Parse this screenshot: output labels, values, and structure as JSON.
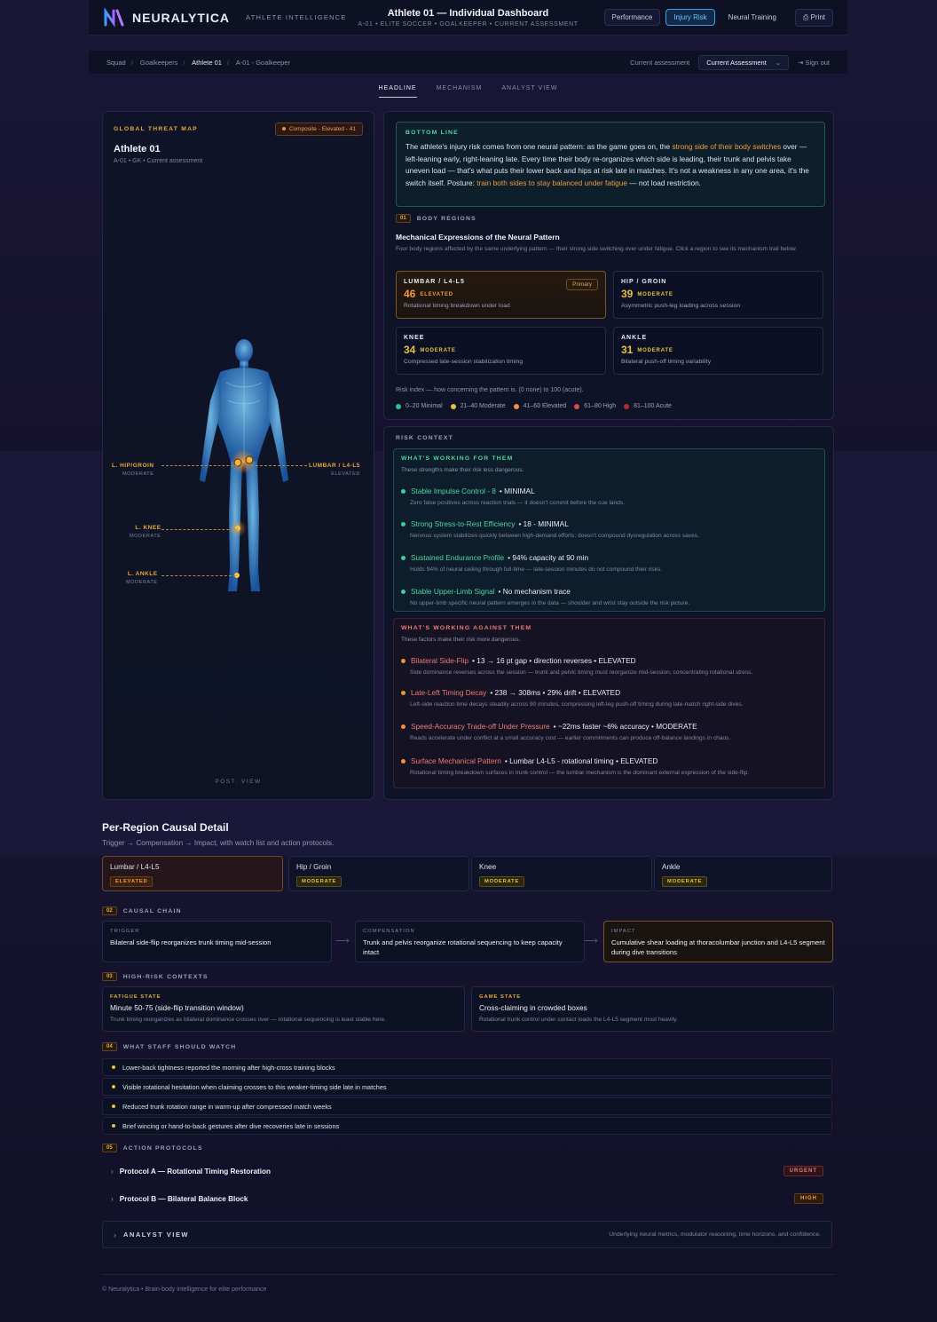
{
  "topbar": {
    "logo": "NEURALYTICA",
    "subtitle": "ATHLETE INTELLIGENCE",
    "title": "Athlete 01 — Individual Dashboard",
    "meta": "A-01  •  ELITE SOCCER  •  GOALKEEPER  •  CURRENT ASSESSMENT",
    "nav": [
      "Performance",
      "Injury Risk",
      "Neural Training"
    ],
    "print": "Print"
  },
  "crumbs": {
    "items": [
      "Squad",
      "Goalkeepers",
      "Athlete 01",
      "A-01 - Goalkeeper"
    ],
    "current_label": "Current assessment",
    "select": "Current Assessment",
    "signout": "Sign out"
  },
  "tabs": [
    "HEADLINE",
    "MECHANISM",
    "ANALYST VIEW"
  ],
  "left": {
    "title": "GLOBAL THREAT MAP",
    "composite": "Composite - Elevated - 41",
    "name": "Athlete 01",
    "sub": "A-01  •  GK  •  Current assessment",
    "callouts": [
      {
        "name": "L. HIP/GROIN",
        "level": "MODERATE"
      },
      {
        "name": "LUMBAR / L4-L5",
        "level": "ELEVATED"
      },
      {
        "name": "L. KNEE",
        "level": "MODERATE"
      },
      {
        "name": "L. ANKLE",
        "level": "MODERATE"
      }
    ],
    "view": "POST. VIEW"
  },
  "bottomline": {
    "title": "BOTTOM LINE",
    "p1": "The athlete's injury risk comes from one neural pattern: as the game goes on, the ",
    "h1": "strong side of their body switches",
    "p2": " over — left-leaning early, right-leaning late. Every time their body re-organizes which side is leading, their trunk and pelvis take uneven load — that's what puts their lower back and hips at risk late in matches. It's not a weakness in any one area, it's the switch itself. Posture: ",
    "h2": "train both sides to stay balanced under fatigue",
    "p3": " — not load restriction."
  },
  "regions": {
    "num": "01",
    "title": "BODY REGIONS",
    "heading": "Mechanical Expressions of the Neural Pattern",
    "desc": "Four body regions affected by the same underlying pattern — their strong side switching over under fatigue. Click a region to see its mechanism trail below.",
    "cards": [
      {
        "name": "LUMBAR / L4-L5",
        "score": "46",
        "level": "ELEVATED",
        "desc": "Rotational timing breakdown under load",
        "tag": "Primary"
      },
      {
        "name": "HIP / GROIN",
        "score": "39",
        "level": "MODERATE",
        "desc": "Asymmetric push-leg loading across session"
      },
      {
        "name": "KNEE",
        "score": "34",
        "level": "MODERATE",
        "desc": "Compressed late-session stabilization timing"
      },
      {
        "name": "ANKLE",
        "score": "31",
        "level": "MODERATE",
        "desc": "Bilateral push-off timing variability"
      }
    ],
    "risk_note": "Risk index — how concerning the pattern is. (0 none) to 100 (acute).",
    "legend": [
      {
        "label": "0–20 Minimal",
        "color": "#2fbf8f"
      },
      {
        "label": "21–40 Moderate",
        "color": "#e4c03d"
      },
      {
        "label": "41–60 Elevated",
        "color": "#f2913c"
      },
      {
        "label": "61–80 High",
        "color": "#e04848"
      },
      {
        "label": "81–100 Acute",
        "color": "#b8282e"
      }
    ]
  },
  "risk": {
    "title": "RISK CONTEXT",
    "for_title": "WHAT'S WORKING FOR THEM",
    "for_sub": "These strengths make their risk less dangerous.",
    "for": [
      {
        "k": "Stable Impulse Control - 8",
        "v": "• MINIMAL",
        "d": "Zero false positives across reaction trials — it doesn't commit before the cue lands."
      },
      {
        "k": "Strong Stress-to-Rest Efficiency",
        "v": "• 18 - MINIMAL",
        "d": "Nervous system stabilizes quickly between high-demand efforts; doesn't compound dysregulation across saves."
      },
      {
        "k": "Sustained Endurance Profile",
        "v": "• 94% capacity at 90 min",
        "d": "Holds 94% of neural ceiling through full-time — late-session minutes do not compound their risks."
      },
      {
        "k": "Stable Upper-Limb Signal",
        "v": "• No mechanism trace",
        "d": "No upper-limb specific neural pattern emerges in the data — shoulder and wrist stay outside the risk picture."
      }
    ],
    "against_title": "WHAT'S WORKING AGAINST THEM",
    "against_sub": "These factors make their risk more dangerous.",
    "against": [
      {
        "k": "Bilateral Side-Flip",
        "v": "• 13 → 16 pt gap • direction reverses • ELEVATED",
        "d": "Side dominance reverses across the session — trunk and pelvic timing must reorganize mid-session, concentrating rotational stress."
      },
      {
        "k": "Late-Left Timing Decay",
        "v": "• 238 → 308ms • 29% drift • ELEVATED",
        "d": "Left-side reaction time decays steadily across 90 minutes, compressing left-leg push-off timing during late-match right-side dives."
      },
      {
        "k": "Speed-Accuracy Trade-off Under Pressure",
        "v": "• ~22ms faster  ~6% accuracy • MODERATE",
        "d": "Reads accelerate under conflict at a small accuracy cost — earlier commitments can produce off-balance landings in chaos."
      },
      {
        "k": "Surface Mechanical Pattern",
        "v": "• Lumbar L4-L5 - rotational timing • ELEVATED",
        "d": "Rotational timing breakdown surfaces in trunk control — the lumbar mechanism is the dominant external expression of the side-flip."
      }
    ]
  },
  "perregion": {
    "title": "Per-Region Causal Detail",
    "sub": "Trigger → Compensation → Impact, with watch list and action protocols.",
    "tabs": [
      {
        "name": "Lumbar / L4-L5",
        "level": "ELEVATED"
      },
      {
        "name": "Hip / Groin",
        "level": "MODERATE"
      },
      {
        "name": "Knee",
        "level": "MODERATE"
      },
      {
        "name": "Ankle",
        "level": "MODERATE"
      }
    ]
  },
  "chain": {
    "num": "02",
    "title": "CAUSAL CHAIN",
    "steps": [
      {
        "label": "TRIGGER",
        "text": "Bilateral side-flip reorganizes trunk timing mid-session"
      },
      {
        "label": "COMPENSATION",
        "text": "Trunk and pelvis reorganize rotational sequencing to keep capacity intact"
      },
      {
        "label": "IMPACT",
        "text": "Cumulative shear loading at thoracolumbar junction and L4-L5 segment during dive transitions"
      }
    ]
  },
  "contexts": {
    "num": "03",
    "title": "HIGH-RISK CONTEXTS",
    "items": [
      {
        "label": "FATIGUE STATE",
        "title": "Minute 50-75 (side-flip transition window)",
        "desc": "Trunk timing reorganizes as bilateral dominance crosses over — rotational sequencing is least stable here."
      },
      {
        "label": "GAME STATE",
        "title": "Cross-claiming in crowded boxes",
        "desc": "Rotational trunk control under contact loads the L4-L5 segment most heavily."
      }
    ]
  },
  "watch": {
    "num": "04",
    "title": "WHAT STAFF SHOULD WATCH",
    "items": [
      "Lower-back tightness reported the morning after high-cross training blocks",
      "Visible rotational hesitation when claiming crosses to this weaker-timing side late in matches",
      "Reduced trunk rotation range in warm-up after compressed match weeks",
      "Brief wincing or hand-to-back gestures after dive recoveries late in sessions"
    ]
  },
  "protocols": {
    "num": "05",
    "title": "ACTION PROTOCOLS",
    "items": [
      {
        "name": "Protocol A — Rotational Timing Restoration",
        "tag": "URGENT"
      },
      {
        "name": "Protocol B — Bilateral Balance Block",
        "tag": "HIGH"
      }
    ]
  },
  "analyst": {
    "label": "ANALYST VIEW",
    "desc": "Underlying neural metrics, modulator reasoning, time horizons, and confidence."
  },
  "footer": "© Neuralytica  •  Brain-body intelligence for elite performance"
}
